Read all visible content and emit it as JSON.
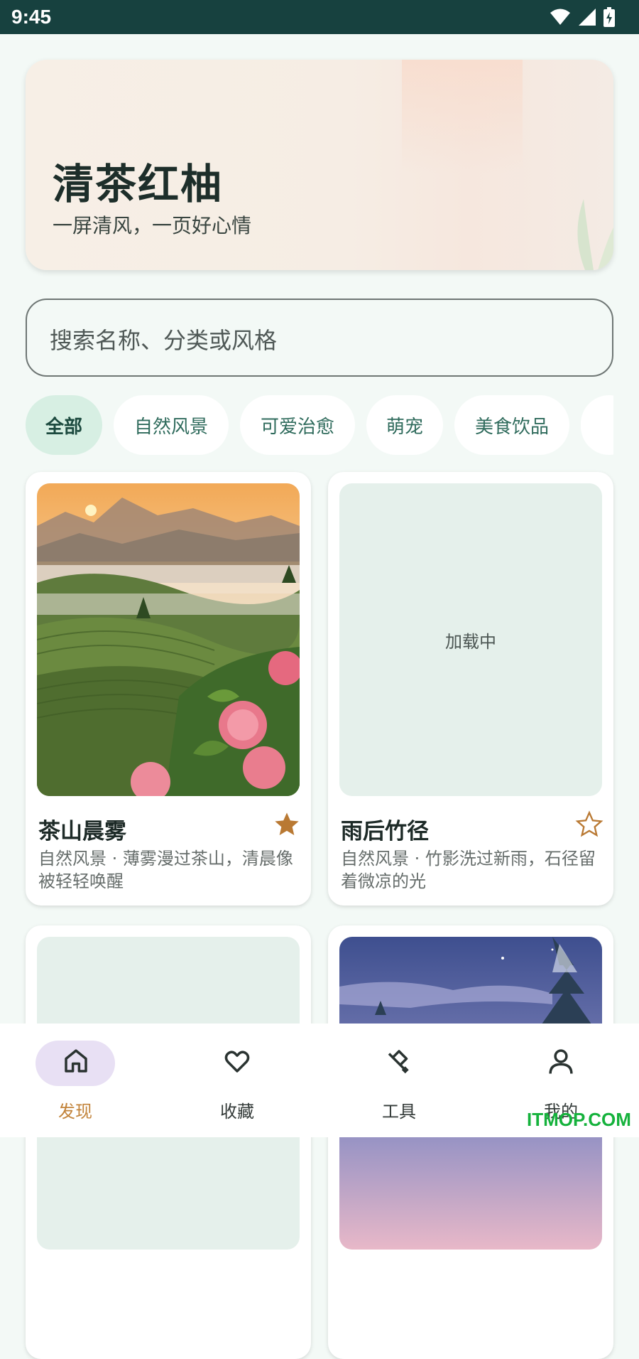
{
  "status_bar": {
    "time": "9:45",
    "icons": [
      "wifi-icon",
      "signal-icon",
      "battery-charging-icon"
    ]
  },
  "hero": {
    "title": "清茶红柚",
    "subtitle": "一屏清风，一页好心情"
  },
  "search": {
    "placeholder": "搜索名称、分类或风格"
  },
  "chips": [
    {
      "label": "全部",
      "selected": true
    },
    {
      "label": "自然风景",
      "selected": false
    },
    {
      "label": "可爱治愈",
      "selected": false
    },
    {
      "label": "萌宠",
      "selected": false
    },
    {
      "label": "美食饮品",
      "selected": false
    }
  ],
  "cards": [
    {
      "title": "茶山晨雾",
      "description": "自然风景 · 薄雾漫过茶山，清晨像被轻轻唤醒",
      "favorited": true,
      "image": "tea-mountain-sunrise"
    },
    {
      "title": "雨后竹径",
      "description": "自然风景 · 竹影洗过新雨，石径留着微凉的光",
      "favorited": false,
      "loading_text": "加载中"
    },
    {
      "title": "",
      "description": "",
      "image": "loading-placeholder"
    },
    {
      "title": "",
      "description": "",
      "image": "snowy-pine-dusk"
    }
  ],
  "bottom_nav": [
    {
      "label": "发现",
      "icon": "home-icon",
      "active": true
    },
    {
      "label": "收藏",
      "icon": "heart-icon",
      "active": false
    },
    {
      "label": "工具",
      "icon": "tools-icon",
      "active": false
    },
    {
      "label": "我的",
      "icon": "person-icon",
      "active": false
    }
  ],
  "watermark": "ITMOP.COM",
  "colors": {
    "status_bar": "#17413f",
    "accent": "#c2833a",
    "chip_selected": "#d7efe3",
    "background": "#f3f9f6"
  }
}
